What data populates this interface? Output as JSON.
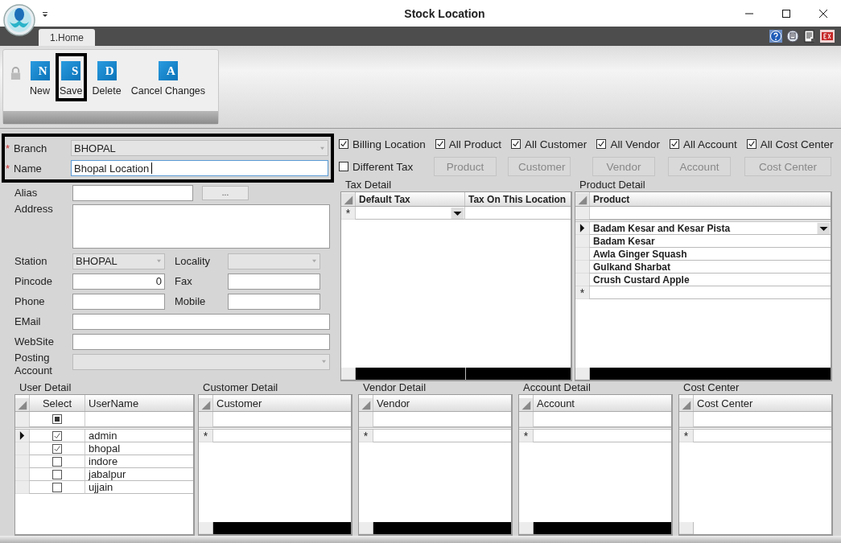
{
  "window": {
    "title": "Stock Location"
  },
  "tabs": [
    {
      "label": "1.Home",
      "selected": true
    }
  ],
  "toolbar": {
    "buttons": [
      {
        "label": "New",
        "icon_letter": "N",
        "highlighted": false
      },
      {
        "label": "Save",
        "icon_letter": "S",
        "highlighted": true
      },
      {
        "label": "Delete",
        "icon_letter": "D",
        "highlighted": false
      },
      {
        "label": "Cancel Changes",
        "icon_letter": "A",
        "highlighted": false
      }
    ]
  },
  "form": {
    "key_fields": {
      "highlighted": true,
      "items": [
        {
          "label": "Branch",
          "required": true,
          "kind": "combo",
          "value": "BHOPAL",
          "disabled": true
        },
        {
          "label": "Name",
          "required": true,
          "kind": "text",
          "value": "Bhopal Location",
          "focused": true
        }
      ]
    },
    "alias": {
      "label": "Alias",
      "button": "..."
    },
    "address": {
      "label": "Address"
    },
    "station": {
      "label": "Station",
      "value": "BHOPAL",
      "disabled": true
    },
    "locality": {
      "label": "Locality",
      "disabled": true
    },
    "pincode": {
      "label": "Pincode",
      "value": "0"
    },
    "fax": {
      "label": "Fax"
    },
    "phone": {
      "label": "Phone"
    },
    "mobile": {
      "label": "Mobile"
    },
    "email": {
      "label": "EMail"
    },
    "website": {
      "label": "WebSite"
    },
    "posting_account": {
      "label": "Posting Account",
      "disabled": true
    }
  },
  "options": [
    {
      "label": "Billing Location",
      "checked": true
    },
    {
      "label": "All Product",
      "checked": true
    },
    {
      "label": "All Customer",
      "checked": true
    },
    {
      "label": "All Vendor",
      "checked": true
    },
    {
      "label": "All Account",
      "checked": true
    },
    {
      "label": "All Cost Center",
      "checked": true
    }
  ],
  "different_tax": {
    "label": "Different Tax",
    "checked": false
  },
  "filter_buttons": [
    {
      "label": "Product",
      "disabled": true
    },
    {
      "label": "Customer",
      "disabled": true
    },
    {
      "label": "Vendor",
      "disabled": true
    },
    {
      "label": "Account",
      "disabled": true
    },
    {
      "label": "Cost Center",
      "disabled": true
    }
  ],
  "tax_detail": {
    "title": "Tax Detail",
    "columns": [
      "Default Tax",
      "Tax On This Location"
    ],
    "new_row_mark": "*",
    "footer_filled": true
  },
  "product_detail": {
    "title": "Product Detail",
    "column": "Product",
    "rows": [
      {
        "name": "Badam Kesar and Kesar Pista",
        "current": true
      },
      {
        "name": "Badam Kesar",
        "current": false
      },
      {
        "name": "Awla Ginger Squash",
        "current": false
      },
      {
        "name": "Gulkand Sharbat",
        "current": false
      },
      {
        "name": "Crush Custard Apple",
        "current": false
      }
    ],
    "new_row_mark": "*",
    "footer_filled": true
  },
  "user_detail": {
    "title": "User Detail",
    "columns": [
      "Select",
      "UserName"
    ],
    "select_all_partial": true,
    "rows": [
      {
        "user": "admin",
        "checked": true,
        "current": true
      },
      {
        "user": "bhopal",
        "checked": true,
        "current": false
      },
      {
        "user": "indore",
        "checked": false,
        "current": false
      },
      {
        "user": "jabalpur",
        "checked": false,
        "current": false
      },
      {
        "user": "ujjain",
        "checked": false,
        "current": false
      }
    ]
  },
  "detail_grids": [
    {
      "title": "Customer Detail",
      "column": "Customer",
      "new_row_mark": "*",
      "footer_filled": true
    },
    {
      "title": "Vendor Detail",
      "column": "Vendor",
      "new_row_mark": "*",
      "footer_filled": true
    },
    {
      "title": "Account Detail",
      "column": "Account",
      "new_row_mark": "*",
      "footer_filled": true
    },
    {
      "title": "Cost Center",
      "column": "Cost Center",
      "new_row_mark": "*",
      "footer_filled": false
    }
  ]
}
